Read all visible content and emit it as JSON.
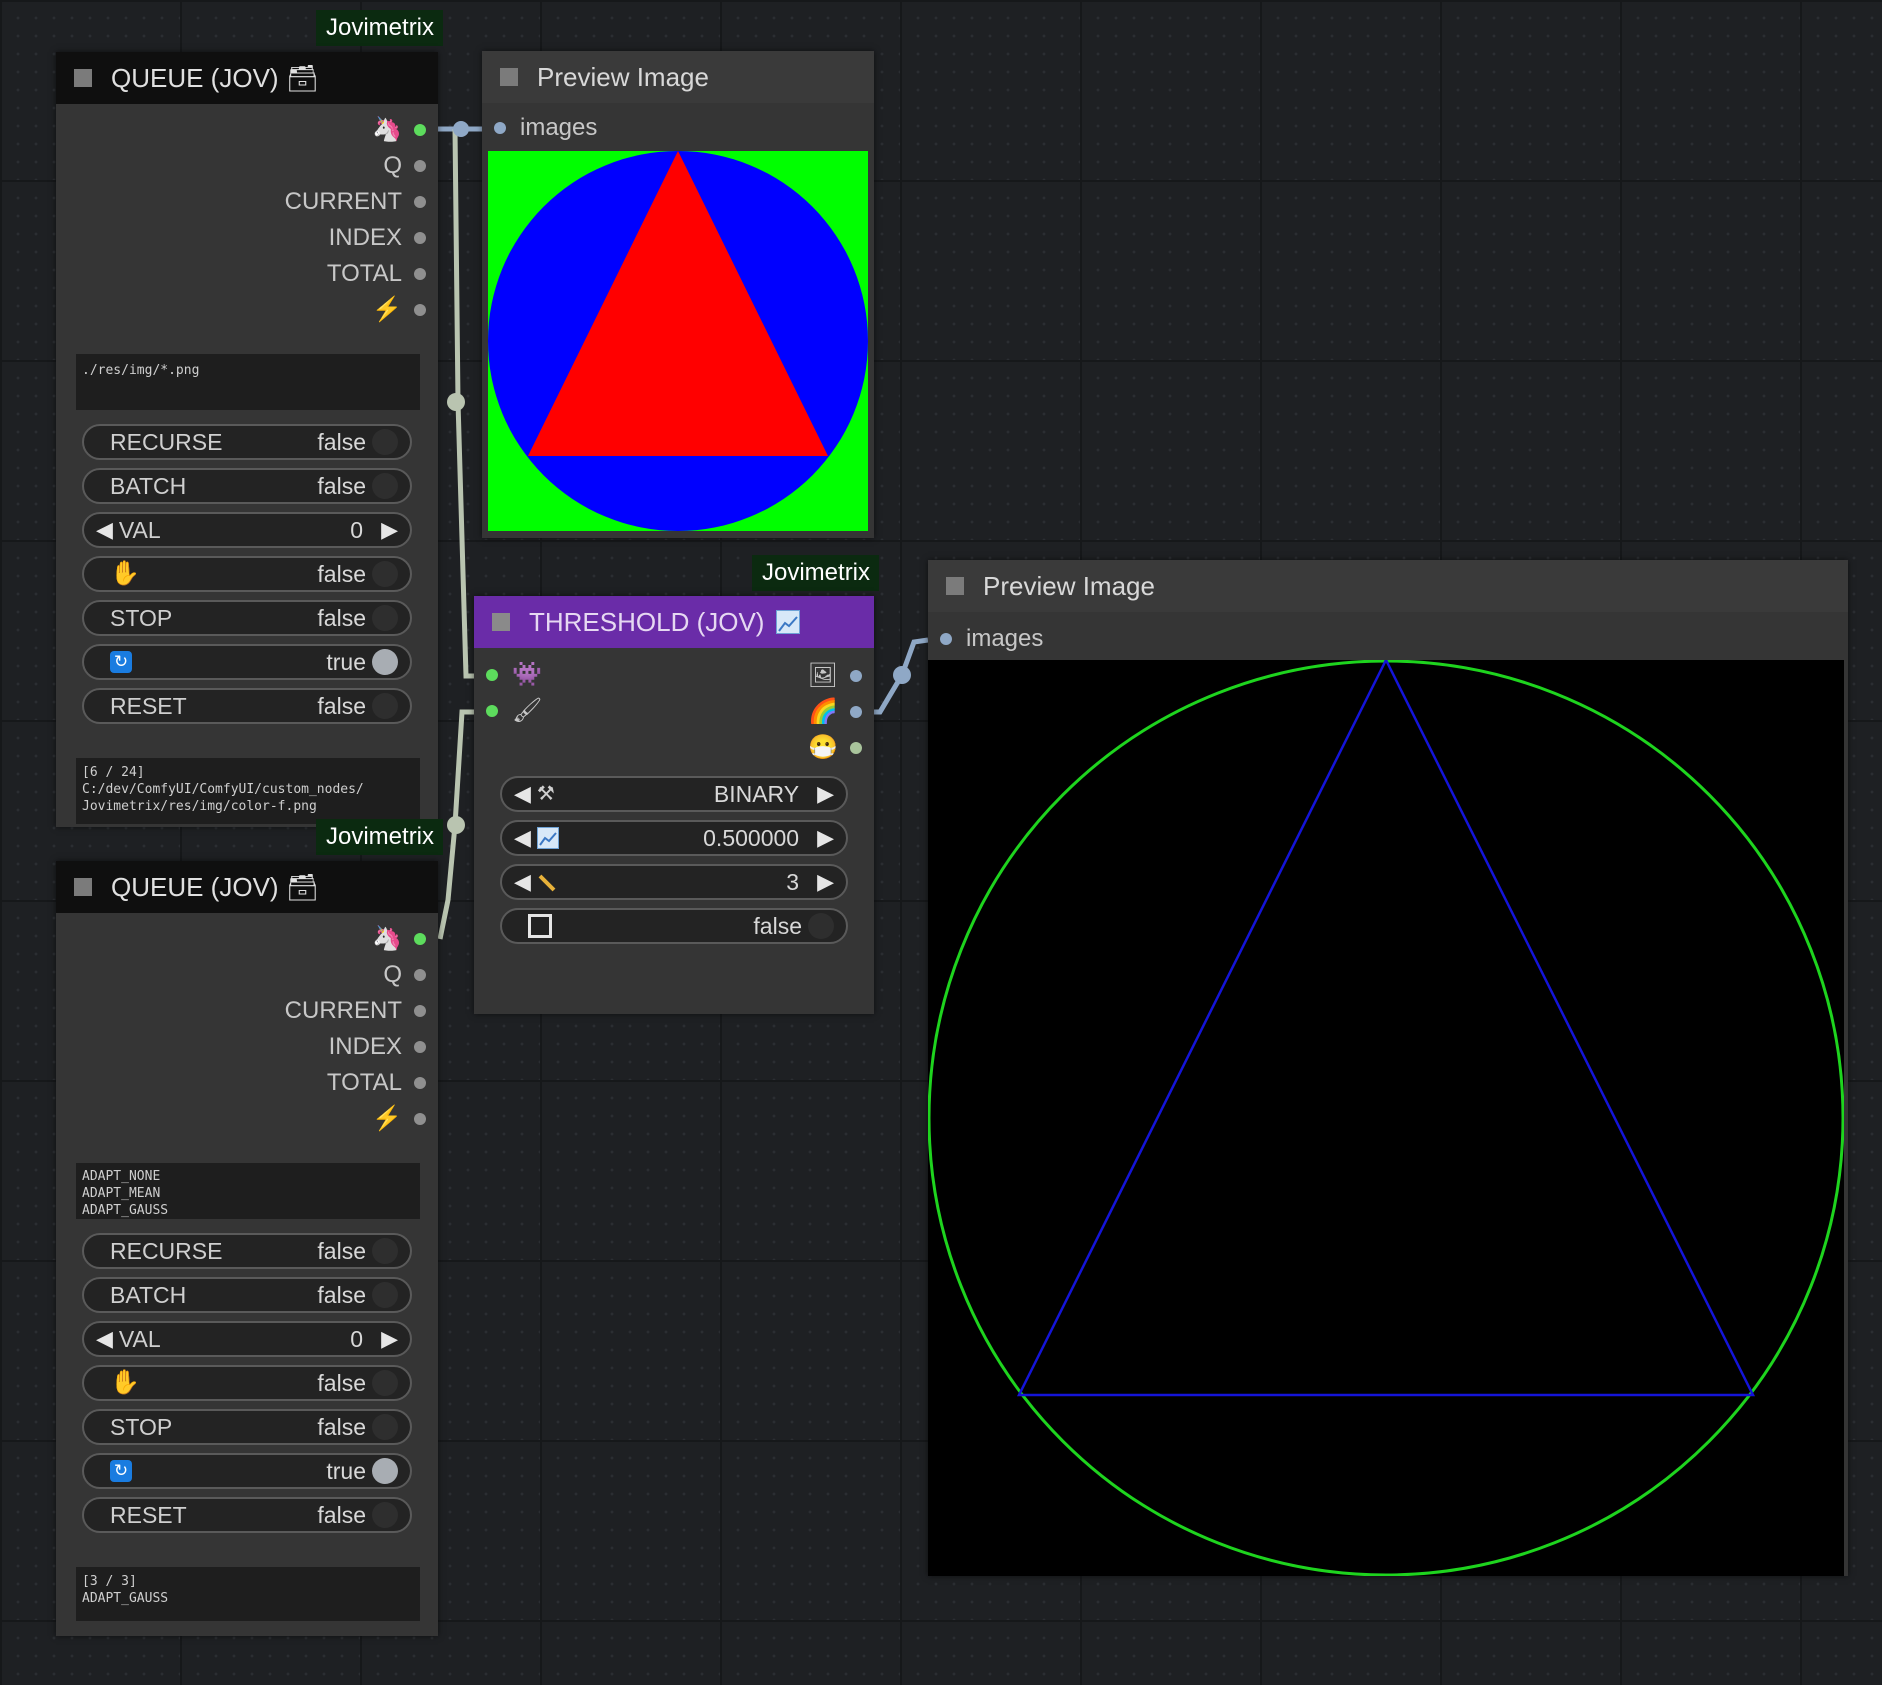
{
  "group_label_1": "Jovimetrix",
  "group_label_2": "Jovimetrix",
  "group_label_3": "Jovimetrix",
  "queue1": {
    "title": "QUEUE (JOV) 🗃",
    "outputs": [
      "Q",
      "CURRENT",
      "INDEX",
      "TOTAL"
    ],
    "textarea": "./res/img/*.png",
    "recurse_label": "RECURSE",
    "recurse_value": "false",
    "batch_label": "BATCH",
    "batch_value": "false",
    "val_label": "VAL",
    "val_value": "0",
    "hold_value": "false",
    "stop_label": "STOP",
    "stop_value": "false",
    "loop_value": "true",
    "reset_label": "RESET",
    "reset_value": "false",
    "status": "[6 / 24]\nC:/dev/ComfyUI/ComfyUI/custom_nodes/\nJovimetrix/res/img/color-f.png"
  },
  "queue2": {
    "title": "QUEUE (JOV) 🗃",
    "outputs": [
      "Q",
      "CURRENT",
      "INDEX",
      "TOTAL"
    ],
    "textarea": "ADAPT_NONE\nADAPT_MEAN\nADAPT_GAUSS",
    "recurse_label": "RECURSE",
    "recurse_value": "false",
    "batch_label": "BATCH",
    "batch_value": "false",
    "val_label": "VAL",
    "val_value": "0",
    "hold_value": "false",
    "stop_label": "STOP",
    "stop_value": "false",
    "loop_value": "true",
    "reset_label": "RESET",
    "reset_value": "false",
    "status": "[3 / 3]\nADAPT_GAUSS"
  },
  "preview1": {
    "title": "Preview Image",
    "input": "images"
  },
  "preview2": {
    "title": "Preview Image",
    "input": "images"
  },
  "threshold": {
    "title": "THRESHOLD (JOV)",
    "mode_value": "BINARY",
    "threshold_value": "0.500000",
    "block_value": "3",
    "invert_value": "false"
  },
  "colors": {
    "canvas": "#1e2023",
    "node_body": "#353535",
    "threshold_title": "#6a2ca8",
    "badge": "#0b2a10",
    "link": "#b9c4b0"
  }
}
